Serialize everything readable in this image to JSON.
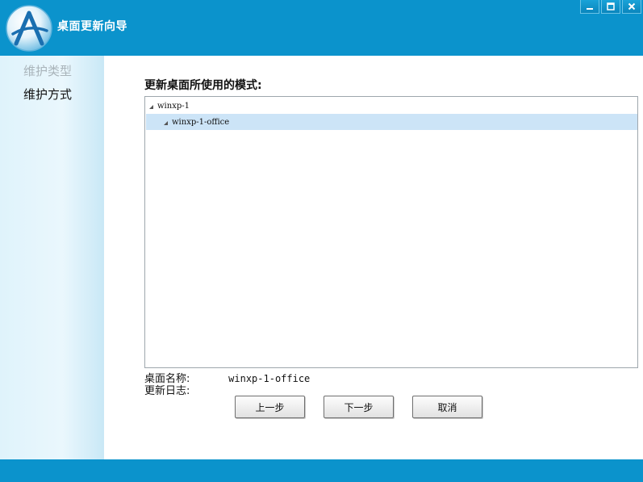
{
  "window": {
    "title": "桌面更新向导",
    "controls": {
      "minimize": "minimize-icon",
      "maximize": "maximize-icon",
      "close": "close-icon"
    }
  },
  "sidebar": {
    "steps": [
      {
        "label": "维护类型",
        "state": "inactive"
      },
      {
        "label": "维护方式",
        "state": "active"
      }
    ]
  },
  "main": {
    "heading": "更新桌面所使用的模式:",
    "tree": {
      "root": {
        "label": "winxp-1"
      },
      "child": {
        "label": "winxp-1-office",
        "selected": true
      }
    },
    "info": {
      "name_label": "桌面名称:",
      "name_value": "winxp-1-office",
      "log_label": "更新日志:",
      "log_value": ""
    },
    "buttons": {
      "prev": "上一步",
      "next": "下一步",
      "cancel": "取消"
    }
  },
  "colors": {
    "frame": "#0b93cc",
    "selection": "#cce4f7",
    "inactive_text": "#a9b4ba"
  }
}
